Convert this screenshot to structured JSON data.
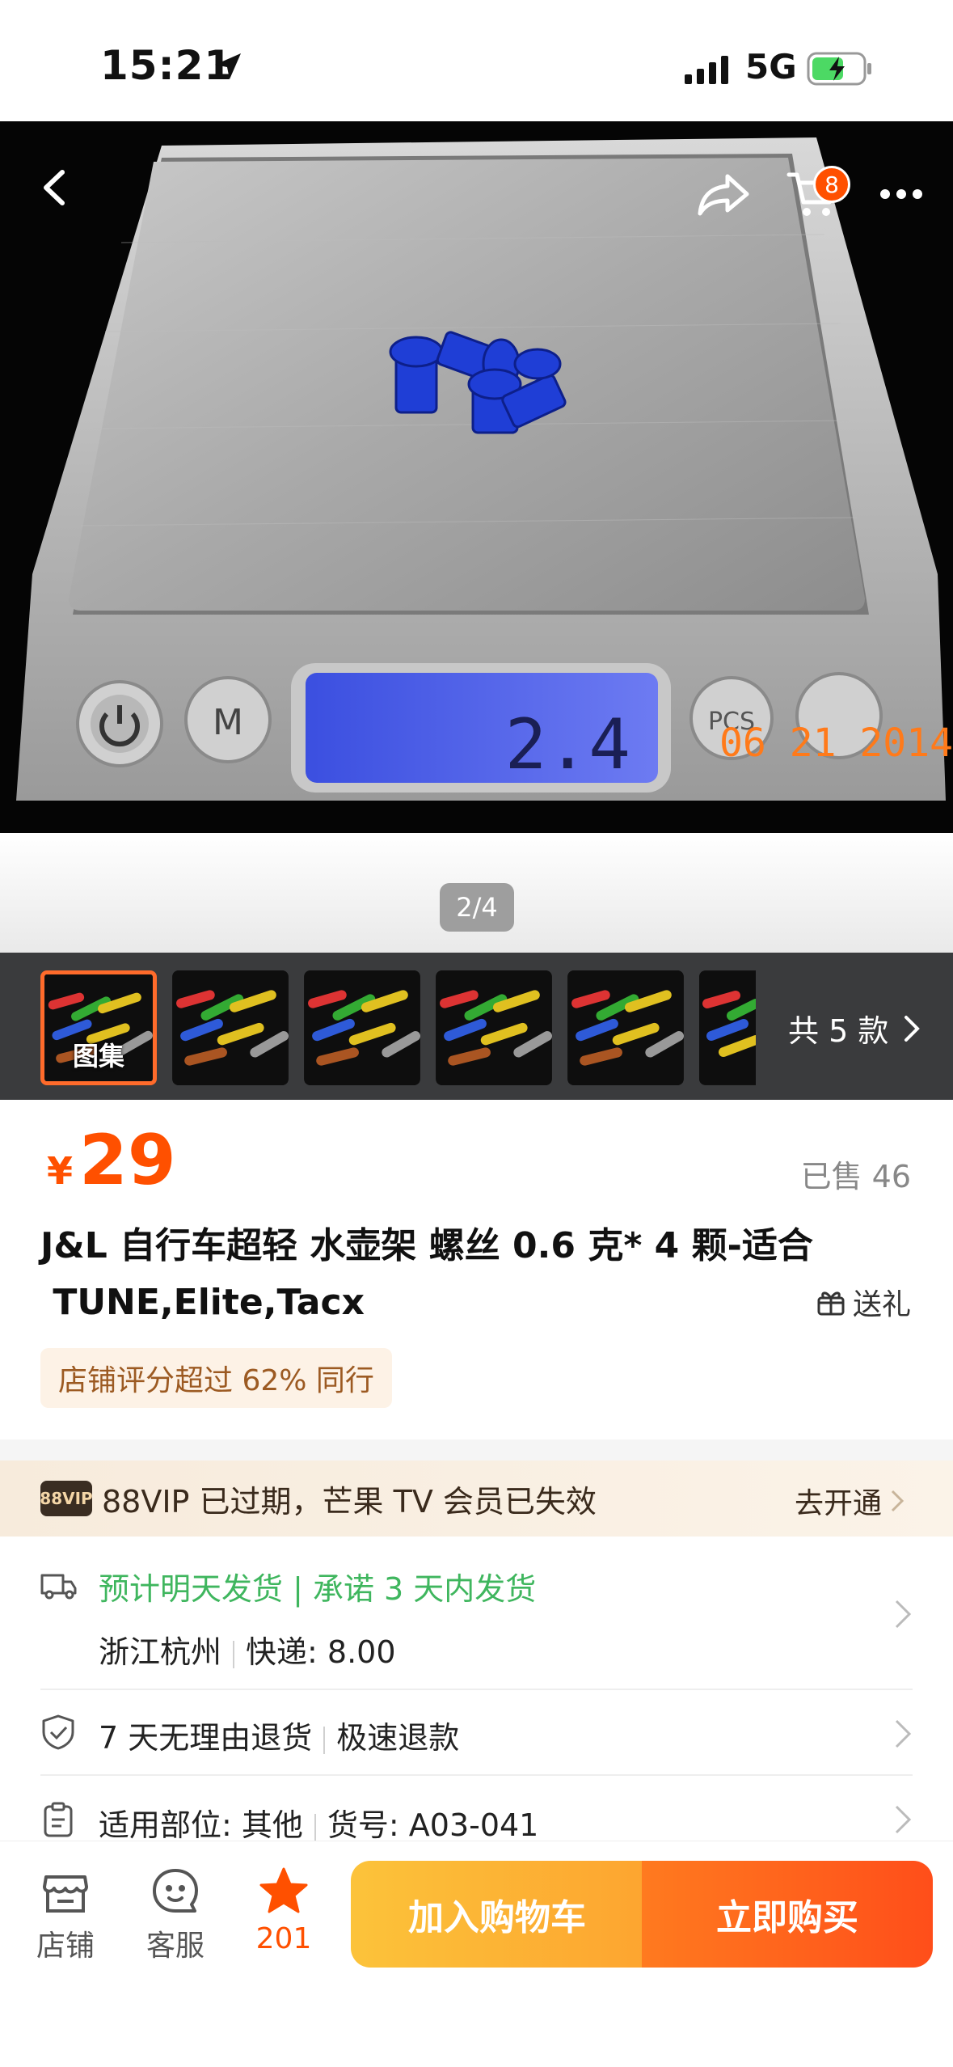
{
  "status_bar": {
    "time": "15:21",
    "network": "5G"
  },
  "header": {
    "cart_badge": "8"
  },
  "gallery": {
    "page_indicator": "2/4",
    "scale_date": "06 21 2014",
    "scale_reading": "2.4"
  },
  "thumbnails": {
    "first_label": "图集",
    "variant_count": "共 5 款"
  },
  "product": {
    "price_symbol": "¥",
    "price": "29",
    "sold": "已售 46",
    "title_line1": "J&L 自行车超轻 水壶架 螺丝 0.6 克* 4 颗-适合",
    "title_line2": " TUNE,Elite,Tacx",
    "gift": "送礼",
    "shop_rating": "店铺评分超过 62% 同行"
  },
  "vip": {
    "badge": "88VIP",
    "text": "88VIP 已过期，芒果 TV 会员已失效",
    "cta": "去开通"
  },
  "shipping": {
    "estimate": "预计明天发货 | 承诺 3 天内发货",
    "origin": "浙江杭州",
    "fee": "快递:  8.00"
  },
  "service": {
    "returns": "7 天无理由退货",
    "refund": "极速退款"
  },
  "params": {
    "part": "适用部位: 其他",
    "sku": "货号: A03-041"
  },
  "bottom_bar": {
    "store": "店铺",
    "service": "客服",
    "favorites": "201",
    "add_to_cart": "加入购物车",
    "buy_now": "立即购买"
  },
  "colors": {
    "accent": "#ff5000",
    "green": "#3fb65e",
    "cart_button": "#fdb234",
    "buy_button": "#ff5a1c"
  }
}
